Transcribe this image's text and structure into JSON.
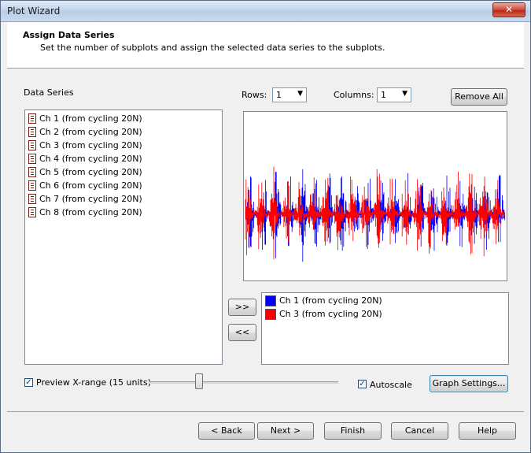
{
  "window": {
    "title": "Plot Wizard",
    "close_glyph": "✕"
  },
  "header": {
    "title": "Assign Data Series",
    "subtitle": "Set the number of subplots and assign the selected data series to the subplots."
  },
  "data_series": {
    "label": "Data Series",
    "icon": "data-series-icon",
    "items": [
      "Ch 1 (from cycling 20N)",
      "Ch 2 (from cycling 20N)",
      "Ch 3 (from cycling 20N)",
      "Ch 4 (from cycling 20N)",
      "Ch 5 (from cycling 20N)",
      "Ch 6 (from cycling 20N)",
      "Ch 7 (from cycling 20N)",
      "Ch 8 (from cycling 20N)"
    ]
  },
  "layout_controls": {
    "rows_label": "Rows:",
    "rows_value": "1",
    "columns_label": "Columns:",
    "columns_value": "1",
    "remove_all_label": "Remove All"
  },
  "transfer": {
    "add_label": ">>",
    "remove_label": "<<"
  },
  "assigned_series": [
    {
      "name": "Ch 1 (from cycling 20N)",
      "color": "#0000ff"
    },
    {
      "name": "Ch 3 (from cycling 20N)",
      "color": "#ff0000"
    }
  ],
  "preview": {
    "checkbox_label": "Preview X-range (15 units)",
    "checked": true,
    "slider_fraction": 0.25
  },
  "autoscale": {
    "label": "Autoscale",
    "checked": true
  },
  "graph_settings_label": "Graph Settings...",
  "footer": {
    "back": "< Back",
    "next": "Next >",
    "finish": "Finish",
    "cancel": "Cancel",
    "help": "Help"
  }
}
